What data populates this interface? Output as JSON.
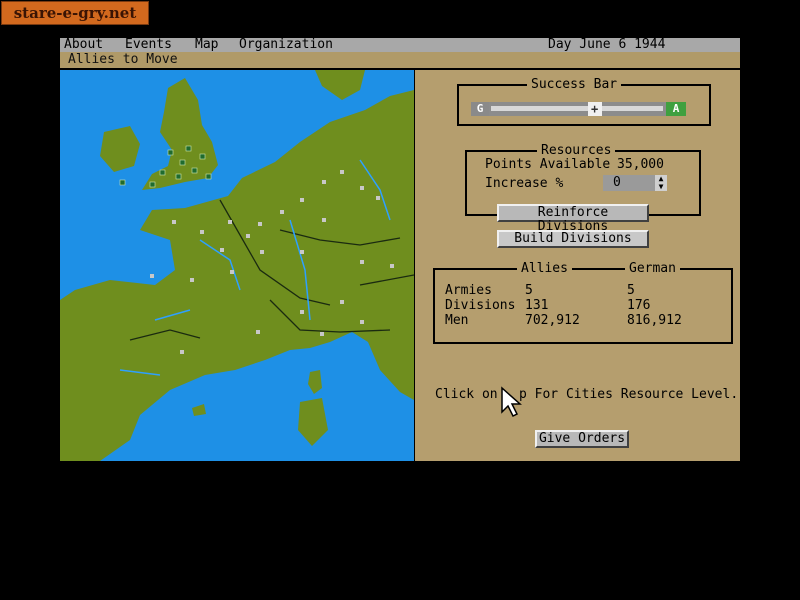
{
  "watermark": "stare-e-gry.net",
  "menu": {
    "about": "About",
    "events": "Events",
    "map": "Map",
    "organization": "Organization",
    "date": "Day June 6 1944"
  },
  "status": "Allies to Move",
  "success_bar": {
    "title": "Success Bar",
    "left": "G",
    "right": "A",
    "level": 0.6
  },
  "resources": {
    "title": "Resources",
    "points_label": "Points Available",
    "points_value": "35,000",
    "increase_label": "Increase %",
    "increase_value": "0"
  },
  "buttons": {
    "reinforce": "Reinforce Divisions",
    "build": "Build Divisions",
    "give_orders": "Give Orders"
  },
  "stats": {
    "col_allies": "Allies",
    "col_german": "German",
    "rows": [
      {
        "label": "Armies",
        "allies": "5",
        "german": "5"
      },
      {
        "label": "Divisions",
        "allies": "131",
        "german": "176"
      },
      {
        "label": "Men",
        "allies": "702,912",
        "german": "816,912"
      }
    ]
  },
  "hint": {
    "before": "Click on",
    "after": "p For Cities Resource Level."
  },
  "colors": {
    "sea": "#1e90e6",
    "land": "#6f8e1e",
    "panel": "#b59e6e"
  },
  "icons": {
    "cursor": "arrow-cursor-icon"
  }
}
